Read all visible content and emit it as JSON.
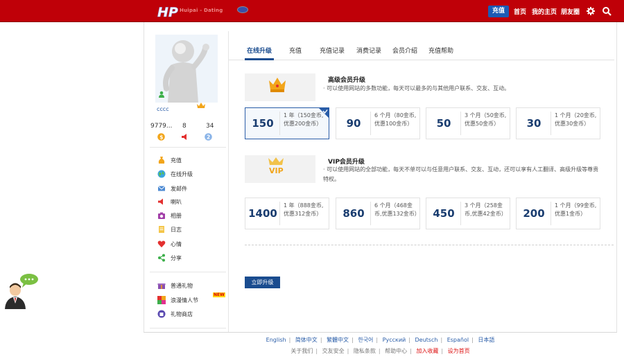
{
  "header": {
    "brand": "Huipai - Dating",
    "nav": {
      "recharge": "充值",
      "home": "首页",
      "my_home": "我的主页",
      "friends": "朋友圈"
    }
  },
  "profile": {
    "username": "cccc",
    "stats": [
      {
        "value": "9779...",
        "icon": "coin-icon"
      },
      {
        "value": "8",
        "icon": "horn-icon"
      },
      {
        "value": "34",
        "icon": "badge-icon"
      }
    ]
  },
  "sidebar": {
    "menu": [
      {
        "label": "充值",
        "icon": "moneybag-icon"
      },
      {
        "label": "在线升级",
        "icon": "globe-icon"
      },
      {
        "label": "发邮件",
        "icon": "mail-icon"
      },
      {
        "label": "喇叭",
        "icon": "horn-icon"
      },
      {
        "label": "相册",
        "icon": "camera-icon"
      },
      {
        "label": "日志",
        "icon": "notebook-icon"
      },
      {
        "label": "心情",
        "icon": "heart-icon"
      },
      {
        "label": "分享",
        "icon": "share-icon"
      }
    ],
    "gifts": [
      {
        "label": "普通礼物",
        "icon": "gift-icon"
      },
      {
        "label": "浪漫情人节",
        "icon": "love-icon"
      },
      {
        "label": "礼物商店",
        "icon": "shop-icon"
      }
    ],
    "new_badge": "NEW"
  },
  "tabs": [
    "在线升级",
    "充值",
    "充值记录",
    "消费记录",
    "会员介绍",
    "充值帮助"
  ],
  "premium": {
    "title": "高级会员升级",
    "desc": "· 可以使用网站的多数功能，每天可以最多的与其他用户联系、交友、互动。",
    "plans": [
      {
        "price": "150",
        "desc": "1 年（150金币,优惠200金币）"
      },
      {
        "price": "90",
        "desc": "6 个月（80金币,优惠100金币）"
      },
      {
        "price": "50",
        "desc": "3 个月（50金币,优惠50金币）"
      },
      {
        "price": "30",
        "desc": "1 个月（20金币,优惠30金币）"
      }
    ]
  },
  "vip": {
    "title": "VIP会员升级",
    "banner_text": "VIP",
    "desc": "· 可以使用网站的全部功能，每天不单可以与任意用户联系、交友、互动，还可以享有人工翻译、高级升级等尊贵特权。",
    "plans": [
      {
        "price": "1400",
        "desc": "1 年（888金币,优惠312金币）"
      },
      {
        "price": "860",
        "desc": "6 个月（468金币,优惠132金币）"
      },
      {
        "price": "450",
        "desc": "3 个月（258金币,优惠42金币）"
      },
      {
        "price": "200",
        "desc": "1 个月（99金币,优惠1金币）"
      }
    ]
  },
  "upgrade_button": "立即升级",
  "footer": {
    "languages": [
      "English",
      "简体中文",
      "繁體中文",
      "한국어",
      "Русский",
      "Deutsch",
      "Español",
      "日本語"
    ],
    "links": [
      "关于我们",
      "交友安全",
      "隐私条款",
      "帮助中心",
      "加入收藏",
      "设为首页"
    ]
  },
  "colors": {
    "header_red": "#bf0008",
    "accent_blue": "#1a4c8f",
    "recharge_blue": "#1c5bb5"
  }
}
